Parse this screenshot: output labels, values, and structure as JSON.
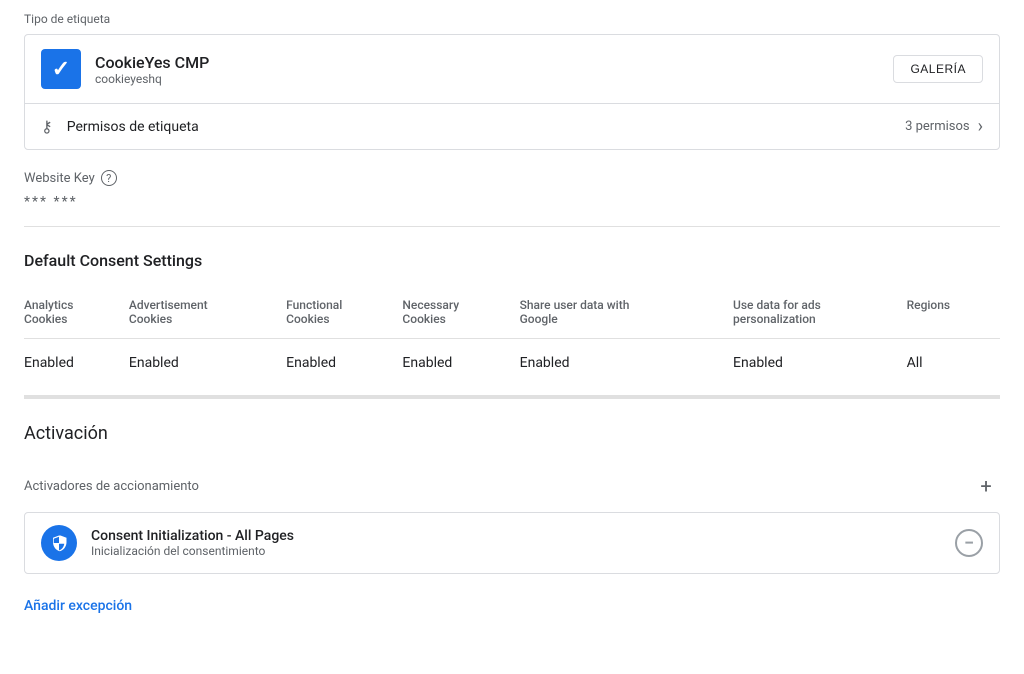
{
  "tipo_label": "Tipo de etiqueta",
  "cookieyes": {
    "name": "CookieYes CMP",
    "domain": "cookieyeshq",
    "gallery_btn": "GALERÍA",
    "permisos_label": "Permisos de etiqueta",
    "permisos_count": "3 permisos"
  },
  "website_key": {
    "label": "Website Key",
    "value": "*** ***"
  },
  "consent": {
    "title": "Default Consent Settings",
    "columns": [
      "Analytics Cookies",
      "Advertisement Cookies",
      "Functional Cookies",
      "Necessary Cookies",
      "Share user data with Google",
      "Use data for ads personalization",
      "Regions"
    ],
    "values": [
      "Enabled",
      "Enabled",
      "Enabled",
      "Enabled",
      "Enabled",
      "Enabled",
      "All"
    ]
  },
  "activation": {
    "title": "Activación",
    "triggers_label": "Activadores de accionamiento",
    "trigger_name": "Consent Initialization - All Pages",
    "trigger_sub": "Inicialización del consentimiento",
    "add_exception_label": "Añadir excepción"
  },
  "icons": {
    "help": "?",
    "chevron_right": "›",
    "add": "+",
    "remove": "−",
    "key": "⚷",
    "shield": "🛡"
  }
}
